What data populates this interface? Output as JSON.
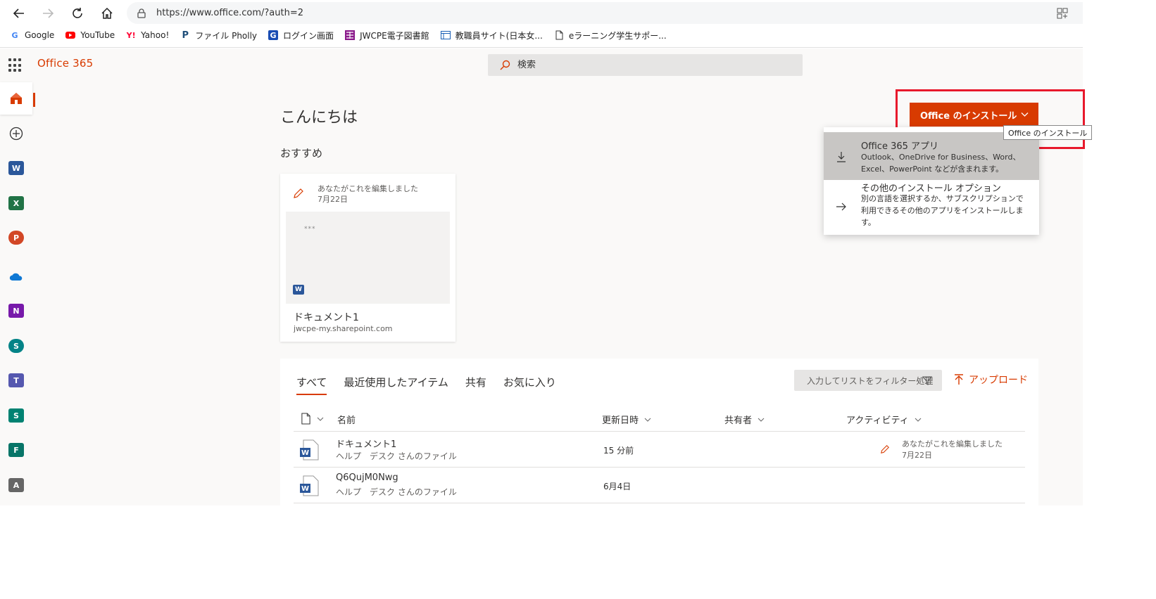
{
  "browser": {
    "url": "https://www.office.com/?auth=2",
    "bookmarks": [
      {
        "label": "Google",
        "icon": "google-icon"
      },
      {
        "label": "YouTube",
        "icon": "youtube-icon"
      },
      {
        "label": "Yahoo!",
        "icon": "yahoo-icon"
      },
      {
        "label": "ファイル  Pholly",
        "icon": "pholly-icon"
      },
      {
        "label": "ログイン画面",
        "icon": "login-g-icon"
      },
      {
        "label": "JWCPE電子図書館",
        "icon": "library-icon"
      },
      {
        "label": "教職員サイト(日本女...",
        "icon": "staff-site-icon"
      },
      {
        "label": "eラーニング学生サポー...",
        "icon": "page-icon"
      }
    ]
  },
  "header": {
    "brand": "Office 365",
    "search_placeholder": "検索"
  },
  "rail": {
    "items": [
      {
        "name": "home",
        "icon": "home-icon"
      },
      {
        "name": "create",
        "icon": "plus-circle-icon"
      },
      {
        "name": "word",
        "icon": "word-icon",
        "letter": "W",
        "color": "#2b579a"
      },
      {
        "name": "excel",
        "icon": "excel-icon",
        "letter": "X",
        "color": "#217346"
      },
      {
        "name": "powerpoint",
        "icon": "powerpoint-icon",
        "letter": "P",
        "color": "#d24726"
      },
      {
        "name": "onedrive",
        "icon": "onedrive-icon"
      },
      {
        "name": "onenote",
        "icon": "onenote-icon",
        "letter": "N",
        "color": "#7719aa"
      },
      {
        "name": "sharepoint",
        "icon": "sharepoint-icon",
        "letter": "S",
        "color": "#038387"
      },
      {
        "name": "teams",
        "icon": "teams-icon",
        "letter": "T",
        "color": "#5558af"
      },
      {
        "name": "sway",
        "icon": "sway-icon",
        "letter": "S",
        "color": "#008272"
      },
      {
        "name": "forms",
        "icon": "forms-icon",
        "letter": "F",
        "color": "#077568"
      },
      {
        "name": "admin",
        "icon": "admin-icon",
        "letter": "A",
        "color": "#666666"
      }
    ]
  },
  "main": {
    "greeting": "こんにちは",
    "recommended_heading": "おすすめ",
    "recommended_card": {
      "activity_line1": "あなたがこれを編集しました",
      "activity_line2": "7月22日",
      "thumb_dots": "***",
      "title": "ドキュメント1",
      "site": "jwcpe-my.sharepoint.com"
    }
  },
  "files": {
    "tabs": [
      "すべて",
      "最近使用したアイテム",
      "共有",
      "お気に入り"
    ],
    "active_tab": 0,
    "filter_placeholder": "入力してリストをフィルター処理",
    "upload_label": "アップロード",
    "columns": {
      "name": "名前",
      "modified": "更新日時",
      "shared": "共有者",
      "activity": "アクティビティ"
    },
    "rows": [
      {
        "name": "ドキュメント1",
        "owner": "ヘルプ　デスク さんのファイル",
        "modified": "15 分前",
        "activity1": "あなたがこれを編集しました",
        "activity2": "7月22日"
      },
      {
        "name": "Q6QujM0Nwg",
        "owner": "ヘルプ　デスク さんのファイル",
        "modified": "6月4日",
        "activity1": "",
        "activity2": ""
      }
    ]
  },
  "install": {
    "button_label": "Office のインストール",
    "tooltip": "Office のインストール",
    "menu": [
      {
        "title": "Office 365 アプリ",
        "desc": "Outlook、OneDrive for Business、Word、Excel、PowerPoint などが含まれます。",
        "icon": "download-icon"
      },
      {
        "title": "その他のインストール オプション",
        "desc": "別の言語を選択するか、サブスクリプションで利用できるその他のアプリをインストールします。",
        "icon": "arrow-right-icon"
      }
    ]
  },
  "colors": {
    "accent": "#d83b01",
    "highlight": "#e8192c"
  }
}
